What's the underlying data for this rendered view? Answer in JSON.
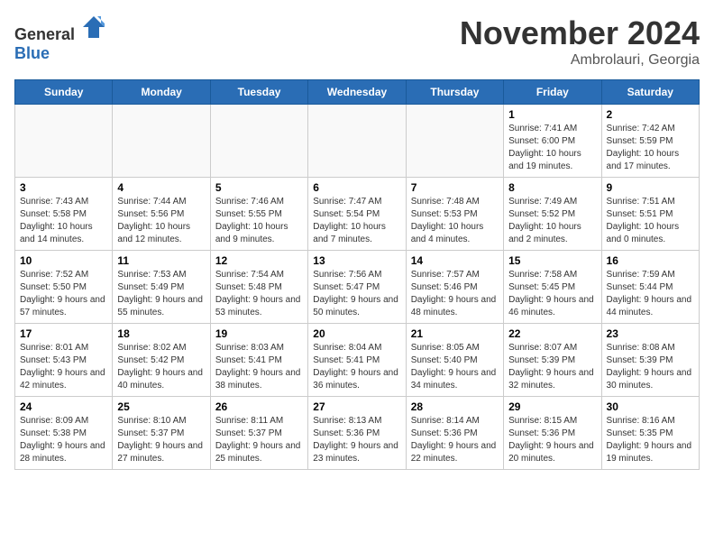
{
  "header": {
    "logo_general": "General",
    "logo_blue": "Blue",
    "month_title": "November 2024",
    "location": "Ambrolauri, Georgia"
  },
  "calendar": {
    "days_of_week": [
      "Sunday",
      "Monday",
      "Tuesday",
      "Wednesday",
      "Thursday",
      "Friday",
      "Saturday"
    ],
    "weeks": [
      [
        {
          "day": "",
          "info": ""
        },
        {
          "day": "",
          "info": ""
        },
        {
          "day": "",
          "info": ""
        },
        {
          "day": "",
          "info": ""
        },
        {
          "day": "",
          "info": ""
        },
        {
          "day": "1",
          "info": "Sunrise: 7:41 AM\nSunset: 6:00 PM\nDaylight: 10 hours and 19 minutes."
        },
        {
          "day": "2",
          "info": "Sunrise: 7:42 AM\nSunset: 5:59 PM\nDaylight: 10 hours and 17 minutes."
        }
      ],
      [
        {
          "day": "3",
          "info": "Sunrise: 7:43 AM\nSunset: 5:58 PM\nDaylight: 10 hours and 14 minutes."
        },
        {
          "day": "4",
          "info": "Sunrise: 7:44 AM\nSunset: 5:56 PM\nDaylight: 10 hours and 12 minutes."
        },
        {
          "day": "5",
          "info": "Sunrise: 7:46 AM\nSunset: 5:55 PM\nDaylight: 10 hours and 9 minutes."
        },
        {
          "day": "6",
          "info": "Sunrise: 7:47 AM\nSunset: 5:54 PM\nDaylight: 10 hours and 7 minutes."
        },
        {
          "day": "7",
          "info": "Sunrise: 7:48 AM\nSunset: 5:53 PM\nDaylight: 10 hours and 4 minutes."
        },
        {
          "day": "8",
          "info": "Sunrise: 7:49 AM\nSunset: 5:52 PM\nDaylight: 10 hours and 2 minutes."
        },
        {
          "day": "9",
          "info": "Sunrise: 7:51 AM\nSunset: 5:51 PM\nDaylight: 10 hours and 0 minutes."
        }
      ],
      [
        {
          "day": "10",
          "info": "Sunrise: 7:52 AM\nSunset: 5:50 PM\nDaylight: 9 hours and 57 minutes."
        },
        {
          "day": "11",
          "info": "Sunrise: 7:53 AM\nSunset: 5:49 PM\nDaylight: 9 hours and 55 minutes."
        },
        {
          "day": "12",
          "info": "Sunrise: 7:54 AM\nSunset: 5:48 PM\nDaylight: 9 hours and 53 minutes."
        },
        {
          "day": "13",
          "info": "Sunrise: 7:56 AM\nSunset: 5:47 PM\nDaylight: 9 hours and 50 minutes."
        },
        {
          "day": "14",
          "info": "Sunrise: 7:57 AM\nSunset: 5:46 PM\nDaylight: 9 hours and 48 minutes."
        },
        {
          "day": "15",
          "info": "Sunrise: 7:58 AM\nSunset: 5:45 PM\nDaylight: 9 hours and 46 minutes."
        },
        {
          "day": "16",
          "info": "Sunrise: 7:59 AM\nSunset: 5:44 PM\nDaylight: 9 hours and 44 minutes."
        }
      ],
      [
        {
          "day": "17",
          "info": "Sunrise: 8:01 AM\nSunset: 5:43 PM\nDaylight: 9 hours and 42 minutes."
        },
        {
          "day": "18",
          "info": "Sunrise: 8:02 AM\nSunset: 5:42 PM\nDaylight: 9 hours and 40 minutes."
        },
        {
          "day": "19",
          "info": "Sunrise: 8:03 AM\nSunset: 5:41 PM\nDaylight: 9 hours and 38 minutes."
        },
        {
          "day": "20",
          "info": "Sunrise: 8:04 AM\nSunset: 5:41 PM\nDaylight: 9 hours and 36 minutes."
        },
        {
          "day": "21",
          "info": "Sunrise: 8:05 AM\nSunset: 5:40 PM\nDaylight: 9 hours and 34 minutes."
        },
        {
          "day": "22",
          "info": "Sunrise: 8:07 AM\nSunset: 5:39 PM\nDaylight: 9 hours and 32 minutes."
        },
        {
          "day": "23",
          "info": "Sunrise: 8:08 AM\nSunset: 5:39 PM\nDaylight: 9 hours and 30 minutes."
        }
      ],
      [
        {
          "day": "24",
          "info": "Sunrise: 8:09 AM\nSunset: 5:38 PM\nDaylight: 9 hours and 28 minutes."
        },
        {
          "day": "25",
          "info": "Sunrise: 8:10 AM\nSunset: 5:37 PM\nDaylight: 9 hours and 27 minutes."
        },
        {
          "day": "26",
          "info": "Sunrise: 8:11 AM\nSunset: 5:37 PM\nDaylight: 9 hours and 25 minutes."
        },
        {
          "day": "27",
          "info": "Sunrise: 8:13 AM\nSunset: 5:36 PM\nDaylight: 9 hours and 23 minutes."
        },
        {
          "day": "28",
          "info": "Sunrise: 8:14 AM\nSunset: 5:36 PM\nDaylight: 9 hours and 22 minutes."
        },
        {
          "day": "29",
          "info": "Sunrise: 8:15 AM\nSunset: 5:36 PM\nDaylight: 9 hours and 20 minutes."
        },
        {
          "day": "30",
          "info": "Sunrise: 8:16 AM\nSunset: 5:35 PM\nDaylight: 9 hours and 19 minutes."
        }
      ]
    ]
  }
}
